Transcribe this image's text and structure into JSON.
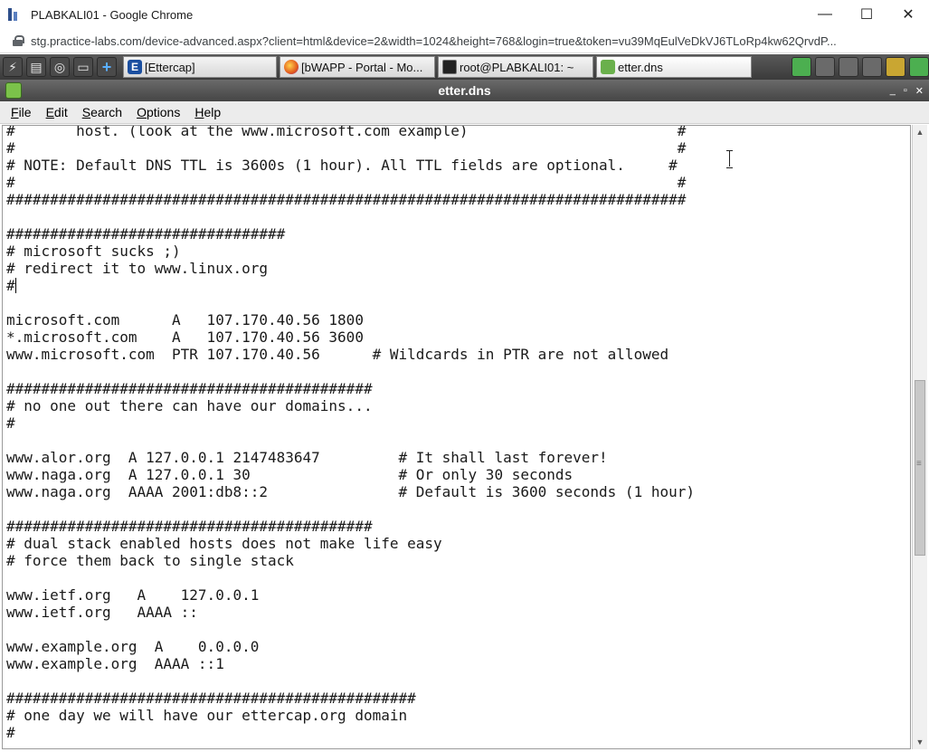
{
  "browser": {
    "window_title": "PLABKALI01 - Google Chrome",
    "minimize": "—",
    "maximize": "☐",
    "close": "✕",
    "url": "stg.practice-labs.com/device-advanced.aspx?client=html&device=2&width=1024&height=768&login=true&token=vu39MqEulVeDkVJ6TLoRp4kw62QrvdP..."
  },
  "taskbar": {
    "tasks": [
      {
        "label": "[Ettercap]",
        "icon": "ettercap-icon"
      },
      {
        "label": "[bWAPP - Portal - Mo...",
        "icon": "firefox-icon"
      },
      {
        "label": "root@PLABKALI01: ~",
        "icon": "terminal-icon"
      },
      {
        "label": "etter.dns",
        "icon": "leafpad-icon"
      }
    ]
  },
  "editor": {
    "window_title": "etter.dns",
    "controls": [
      "_",
      "▫",
      "✕"
    ],
    "menu": [
      {
        "key": "F",
        "rest": "ile"
      },
      {
        "key": "E",
        "rest": "dit"
      },
      {
        "key": "S",
        "rest": "earch"
      },
      {
        "key": "O",
        "rest": "ptions"
      },
      {
        "key": "H",
        "rest": "elp"
      }
    ],
    "lines": [
      "#       host. (look at the www.microsoft.com example)                        #",
      "#                                                                            #",
      "# NOTE: Default DNS TTL is 3600s (1 hour). All TTL fields are optional.     #",
      "#                                                                            #",
      "##############################################################################",
      "",
      "################################",
      "# microsoft sucks ;)",
      "# redirect it to www.linux.org",
      "#",
      "",
      "microsoft.com      A   107.170.40.56 1800",
      "*.microsoft.com    A   107.170.40.56 3600",
      "www.microsoft.com  PTR 107.170.40.56      # Wildcards in PTR are not allowed",
      "",
      "##########################################",
      "# no one out there can have our domains...",
      "#",
      "",
      "www.alor.org  A 127.0.0.1 2147483647         # It shall last forever!",
      "www.naga.org  A 127.0.0.1 30                 # Or only 30 seconds",
      "www.naga.org  AAAA 2001:db8::2               # Default is 3600 seconds (1 hour)",
      "",
      "##########################################",
      "# dual stack enabled hosts does not make life easy",
      "# force them back to single stack",
      "",
      "www.ietf.org   A    127.0.0.1",
      "www.ietf.org   AAAA ::",
      "",
      "www.example.org  A    0.0.0.0",
      "www.example.org  AAAA ::1",
      "",
      "###############################################",
      "# one day we will have our ettercap.org domain",
      "#"
    ]
  }
}
